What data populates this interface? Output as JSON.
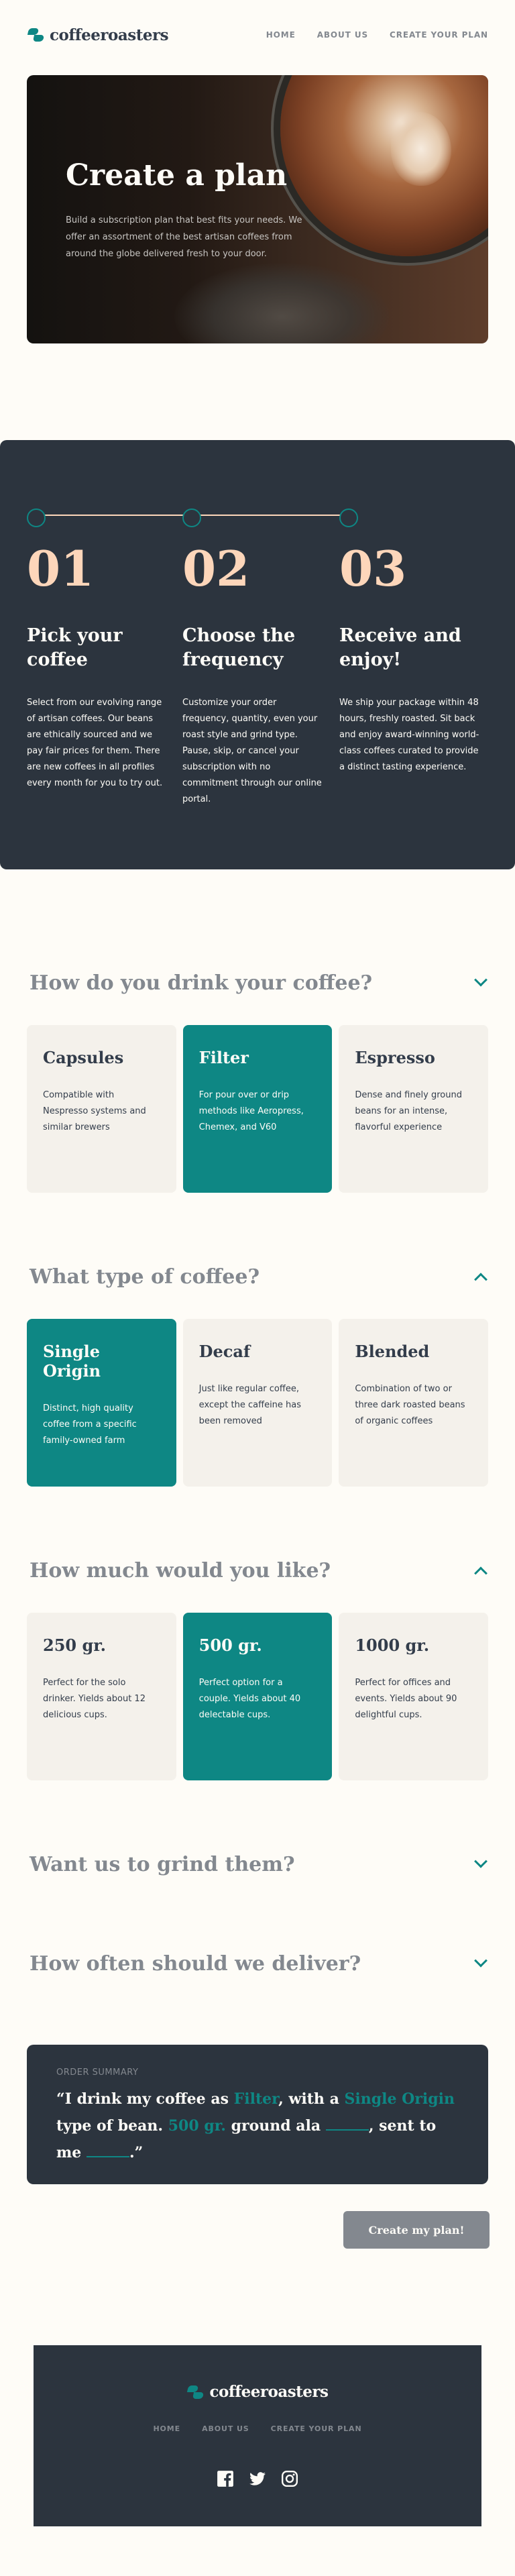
{
  "brand": {
    "name": "coffeeroasters"
  },
  "nav": {
    "home": "HOME",
    "about": "ABOUT US",
    "plan": "CREATE YOUR PLAN"
  },
  "hero": {
    "title": "Create a plan",
    "text": "Build a subscription plan that best fits your needs. We offer an assortment of the best artisan coffees from around the globe delivered fresh to your door."
  },
  "steps": [
    {
      "number": "01",
      "title": "Pick your coffee",
      "text": "Select from our evolving range of artisan coffees. Our beans are ethically sourced and we pay fair prices for them. There are new coffees in all profiles every month for you to try out."
    },
    {
      "number": "02",
      "title": "Choose the frequency",
      "text": "Customize your order frequency, quantity, even your roast style and grind type. Pause, skip, or cancel your subscription with no commitment through our online portal."
    },
    {
      "number": "03",
      "title": "Receive and enjoy!",
      "text": "We ship your package within 48 hours, freshly roasted. Sit back and enjoy award-winning world-class coffees curated to provide a distinct tasting experience."
    }
  ],
  "questions": [
    {
      "title": "How do you drink your coffee?",
      "expanded": true,
      "selected_index": 1,
      "options": [
        {
          "title": "Capsules",
          "text": "Compatible with Nespresso systems and similar brewers"
        },
        {
          "title": "Filter",
          "text": "For pour over or drip methods like Aeropress, Chemex, and V60"
        },
        {
          "title": "Espresso",
          "text": "Dense and finely ground beans for an intense, flavorful experience"
        }
      ]
    },
    {
      "title": "What type of coffee?",
      "expanded": true,
      "selected_index": 0,
      "options": [
        {
          "title": "Single Origin",
          "text": "Distinct, high quality coffee from a specific family-owned farm"
        },
        {
          "title": "Decaf",
          "text": "Just like regular coffee, except the caffeine has been removed"
        },
        {
          "title": "Blended",
          "text": "Combination of two or three dark roasted beans of organic coffees"
        }
      ]
    },
    {
      "title": "How much would you like?",
      "expanded": true,
      "selected_index": 1,
      "options": [
        {
          "title": "250 gr.",
          "text": "Perfect for the solo drinker. Yields about 12 delicious cups."
        },
        {
          "title": "500 gr.",
          "text": "Perfect option for a couple. Yields about 40 delectable cups."
        },
        {
          "title": "1000 gr.",
          "text": "Perfect for offices and events. Yields about 90 delightful cups."
        }
      ]
    },
    {
      "title": "Want us to grind them?",
      "expanded": false
    },
    {
      "title": "How often should we deliver?",
      "expanded": false
    }
  ],
  "summary": {
    "label": "ORDER SUMMARY",
    "open_quote": "“I drink my coffee as",
    "method": "Filter",
    "with_a": ", with a",
    "type": "Single Origin",
    "type_of_bean": "type of bean.",
    "quantity": "500 gr.",
    "ground_ala": "ground ala",
    "sent_to_me": ", sent to me",
    "close_quote": ".”"
  },
  "cta": {
    "label": "Create my plan!"
  },
  "social": [
    "facebook-icon",
    "twitter-icon",
    "instagram-icon"
  ],
  "colors": {
    "accent": "#0e8784",
    "dark": "#2c343e",
    "peach": "#fdd6ba",
    "muted": "#83888f",
    "cream": "#fefcf7",
    "card": "#f4f1eb"
  }
}
